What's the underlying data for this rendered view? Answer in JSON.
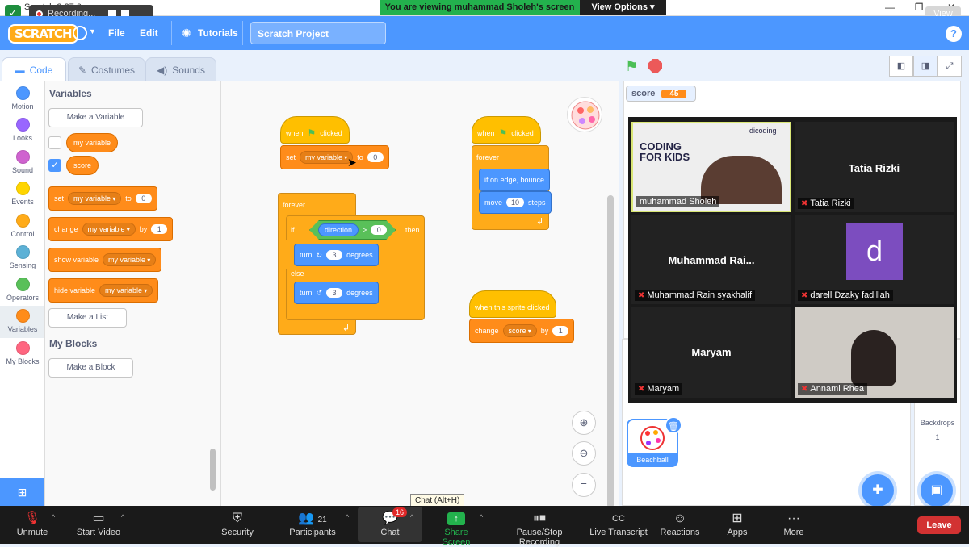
{
  "window": {
    "title": "Scratch 3.27.0",
    "recording_label": "Recording...",
    "share_banner": "You are viewing muhammad Sholeh's screen",
    "view_options": "View Options",
    "view_button": "View"
  },
  "menubar": {
    "logo": "SCRATCH",
    "file": "File",
    "edit": "Edit",
    "tutorials": "Tutorials",
    "project_title": "Scratch Project",
    "help": "?"
  },
  "tabs": {
    "code": "Code",
    "costumes": "Costumes",
    "sounds": "Sounds"
  },
  "categories": [
    {
      "label": "Motion",
      "color": "#4c97ff"
    },
    {
      "label": "Looks",
      "color": "#9966ff"
    },
    {
      "label": "Sound",
      "color": "#cf63cf"
    },
    {
      "label": "Events",
      "color": "#ffd500"
    },
    {
      "label": "Control",
      "color": "#ffab19"
    },
    {
      "label": "Sensing",
      "color": "#5cb1d6"
    },
    {
      "label": "Operators",
      "color": "#59c059"
    },
    {
      "label": "Variables",
      "color": "#ff8c1a"
    },
    {
      "label": "My Blocks",
      "color": "#ff6680"
    }
  ],
  "palette": {
    "heading": "Variables",
    "make_variable": "Make a Variable",
    "var_my_variable": "my variable",
    "var_score": "score",
    "set": {
      "word": "set",
      "var": "my variable",
      "to": "to",
      "value": "0"
    },
    "change": {
      "word": "change",
      "var": "my variable",
      "by": "by",
      "value": "1"
    },
    "show": {
      "word": "show variable",
      "var": "my variable"
    },
    "hide": {
      "word": "hide variable",
      "var": "my variable"
    },
    "make_list": "Make a List",
    "my_blocks_heading": "My Blocks",
    "make_block": "Make a Block"
  },
  "scripts": {
    "s1_when": "when",
    "s1_clicked": "clicked",
    "s1_set": "set",
    "s1_var": "my variable",
    "s1_to": "to",
    "s1_value": "0",
    "s2_forever": "forever",
    "s2_if": "if",
    "s2_reporter": "direction",
    "s2_op": ">",
    "s2_value": "0",
    "s2_then": "then",
    "s2_turn1": "turn",
    "s2_turn1_val": "3",
    "s2_degrees1": "degrees",
    "s2_else": "else",
    "s2_turn2": "turn",
    "s2_turn2_val": "3",
    "s2_degrees2": "degrees",
    "s3_when": "when",
    "s3_clicked": "clicked",
    "s3_forever": "forever",
    "s3_bounce": "if on edge, bounce",
    "s3_move": "move",
    "s3_move_val": "10",
    "s3_steps": "steps",
    "s4_hat": "when this sprite clicked",
    "s4_change": "change",
    "s4_var": "score",
    "s4_by": "by",
    "s4_value": "1"
  },
  "stage": {
    "monitor_label": "score",
    "monitor_value": "45"
  },
  "participants": [
    {
      "name": "muhammad Sholeh",
      "display": "",
      "video": true
    },
    {
      "name": "Tatia Rizki",
      "display": "Tatia Rizki",
      "video": false
    },
    {
      "name": "Muhammad Rain syakhalif",
      "display": "Muhammad  Rai...",
      "video": false
    },
    {
      "name": "darell Dzaky fadillah",
      "display": "d",
      "video": false
    },
    {
      "name": "Maryam",
      "display": "Maryam",
      "video": false
    },
    {
      "name": "Annami Rhea",
      "display": "",
      "video": true
    }
  ],
  "shared_video_text": "CODING FOR KIDS",
  "shared_video_brand": "dicoding",
  "sprite": {
    "name": "Beachball"
  },
  "backdrops": {
    "label": "Backdrops",
    "count": "1"
  },
  "tooltip": "Chat (Alt+H)",
  "toolbar": {
    "unmute": "Unmute",
    "start_video": "Start Video",
    "security": "Security",
    "participants": "Participants",
    "participants_count": "21",
    "chat": "Chat",
    "chat_badge": "16",
    "share_screen": "Share Screen",
    "pause_stop": "Pause/Stop Recording",
    "live_transcript": "Live Transcript",
    "reactions": "Reactions",
    "apps": "Apps",
    "more": "More",
    "leave": "Leave"
  }
}
